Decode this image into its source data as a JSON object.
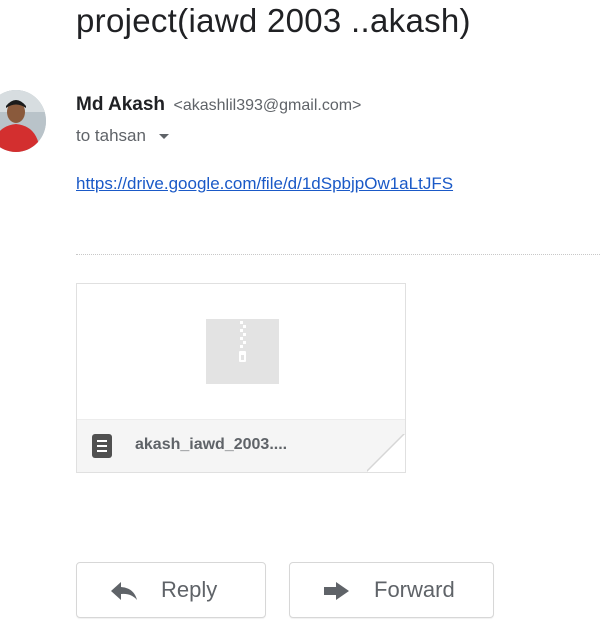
{
  "email": {
    "subject": "project(iawd 2003 ..akash)",
    "sender_name": "Md Akash",
    "sender_email": "<akashlil393@gmail.com>",
    "to_line": "to tahsan",
    "link": "https://drive.google.com/file/d/1dSpbjpOw1aLtJFS"
  },
  "attachment": {
    "filename": "akash_iawd_2003....",
    "icon": "archive-file-icon"
  },
  "actions": {
    "reply_label": "Reply",
    "forward_label": "Forward"
  },
  "colors": {
    "link": "#1a59c7",
    "secondary_text": "#5f6368",
    "avatar_shirt": "#d32f2f"
  }
}
